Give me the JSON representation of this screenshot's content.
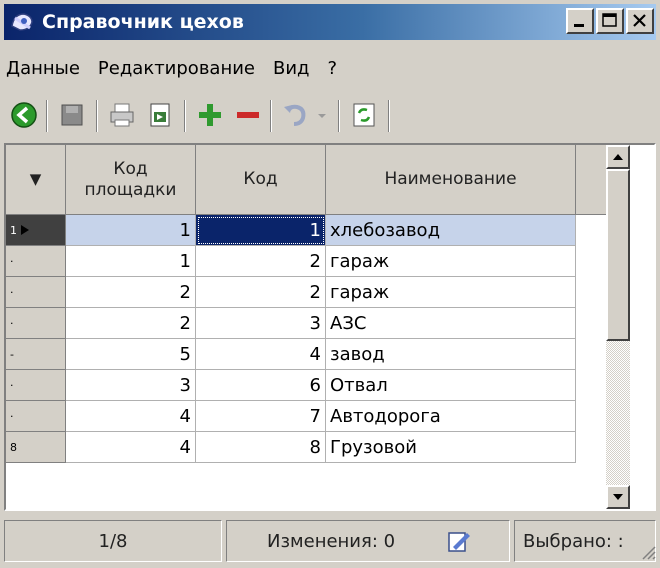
{
  "window": {
    "title": "Справочник цехов"
  },
  "menu": [
    "Данные",
    "Редактирование",
    "Вид",
    "?"
  ],
  "toolbar": {
    "buttons": [
      "back-icon",
      "save-icon",
      "print-icon",
      "export-icon",
      "add-icon",
      "remove-icon",
      "undo-icon",
      "refresh-icon"
    ]
  },
  "grid": {
    "headers": {
      "indicator": "▼",
      "area_code_l1": "Код",
      "area_code_l2": "площадки",
      "code": "Код",
      "name": "Наименование"
    },
    "rows": [
      {
        "ind": "1",
        "area": "1",
        "code": "1",
        "name": "хлебозавод",
        "active": true
      },
      {
        "ind": "·",
        "area": "1",
        "code": "2",
        "name": "гараж"
      },
      {
        "ind": "·",
        "area": "2",
        "code": "2",
        "name": "гараж"
      },
      {
        "ind": "·",
        "area": "2",
        "code": "3",
        "name": "АЗС"
      },
      {
        "ind": "-",
        "area": "5",
        "code": "4",
        "name": "завод"
      },
      {
        "ind": "·",
        "area": "3",
        "code": "6",
        "name": "Отвал"
      },
      {
        "ind": "·",
        "area": "4",
        "code": "7",
        "name": "Автодорога"
      },
      {
        "ind": "8",
        "area": "4",
        "code": "8",
        "name": "Грузовой"
      }
    ]
  },
  "status": {
    "position": "1/8",
    "changes": "Изменения: 0",
    "selected": "Выбрано: :"
  }
}
